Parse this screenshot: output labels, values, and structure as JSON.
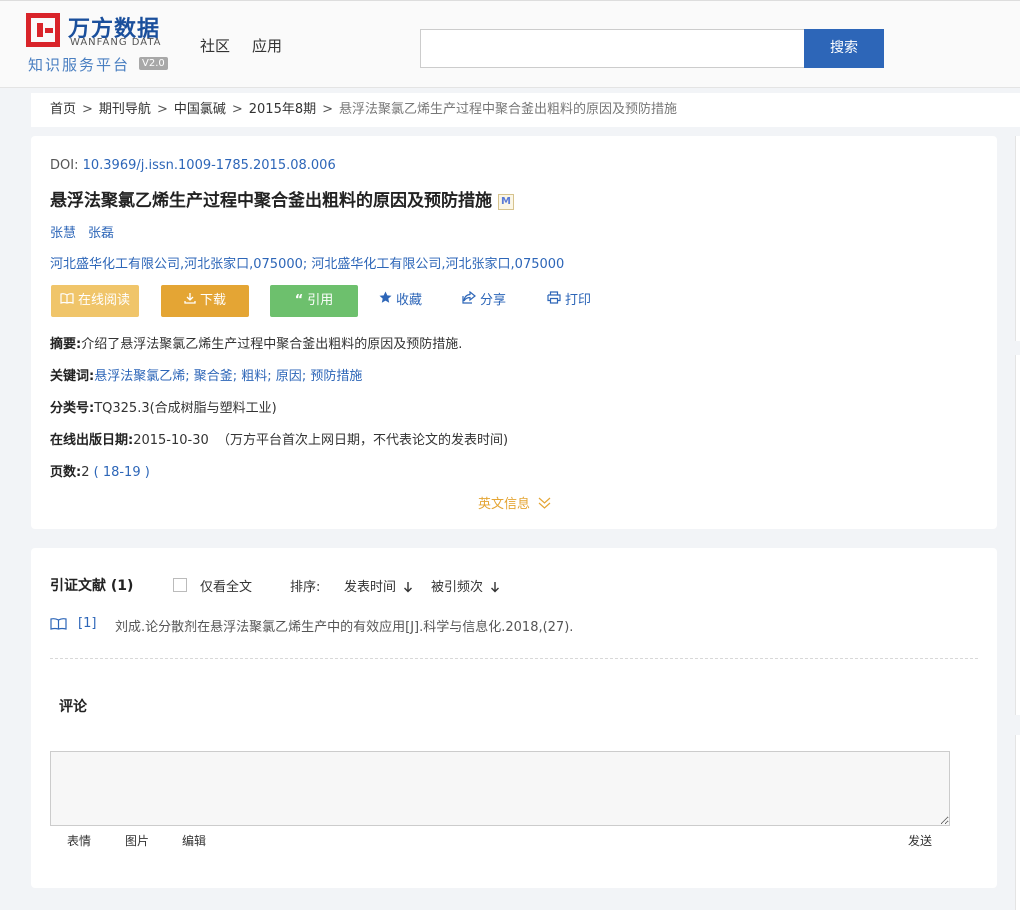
{
  "header": {
    "logo_cn": "万方数据",
    "logo_en": "WANFANG DATA",
    "logo_slogan": "知识服务平台",
    "logo_version": "V2.0",
    "nav": [
      "社区",
      "应用"
    ],
    "search_value": "",
    "search_button": "搜索"
  },
  "breadcrumb": {
    "items": [
      "首页",
      "期刊导航",
      "中国氯碱",
      "2015年8期"
    ],
    "separator": ">",
    "current": "悬浮法聚氯乙烯生产过程中聚合釜出粗料的原因及预防措施"
  },
  "article": {
    "doi_label": "DOI:",
    "doi": "10.3969/j.issn.1009-1785.2015.08.006",
    "title": "悬浮法聚氯乙烯生产过程中聚合釜出粗料的原因及预防措施",
    "badge": "M",
    "authors": [
      "张慧",
      "张磊"
    ],
    "affiliations": "河北盛华化工有限公司,河北张家口,075000; 河北盛华化工有限公司,河北张家口,075000",
    "actions": {
      "read": "在线阅读",
      "download": "下载",
      "cite": "引用",
      "favorite": "收藏",
      "share": "分享",
      "print": "打印"
    },
    "abstract_label": "摘要:",
    "abstract": "介绍了悬浮法聚氯乙烯生产过程中聚合釜出粗料的原因及预防措施.",
    "keywords_label": "关键词:",
    "keywords": [
      "悬浮法聚氯乙烯",
      "聚合釜",
      "粗料",
      "原因",
      "预防措施"
    ],
    "classification_label": "分类号:",
    "classification": "TQ325.3(合成树脂与塑料工业)",
    "pubdate_label": "在线出版日期:",
    "pubdate": "2015-10-30",
    "pubdate_note": "（万方平台首次上网日期，不代表论文的发表时间)",
    "pages_label": "页数:",
    "pages_count": "2",
    "pages_range": "18-19",
    "english_info": "英文信息"
  },
  "citations": {
    "heading": "引证文献 (1)",
    "fulltext_only": "仅看全文",
    "sort_label": "排序:",
    "sort_options": [
      "发表时间",
      "被引频次"
    ],
    "items": [
      {
        "num": "[1]",
        "text": "刘成.论分散剂在悬浮法聚氯乙烯生产中的有效应用[J].科学与信息化.2018,(27)."
      }
    ]
  },
  "comments": {
    "heading": "评论",
    "value": "",
    "tools": [
      "表情",
      "图片",
      "编辑"
    ],
    "send": "发送"
  },
  "colors": {
    "link": "#2d66b8",
    "read_btn": "#f0c56a",
    "download_btn": "#e4a534",
    "cite_btn": "#6dc06d",
    "search_btn": "#2d66b8",
    "brand_red": "#d9242a"
  }
}
